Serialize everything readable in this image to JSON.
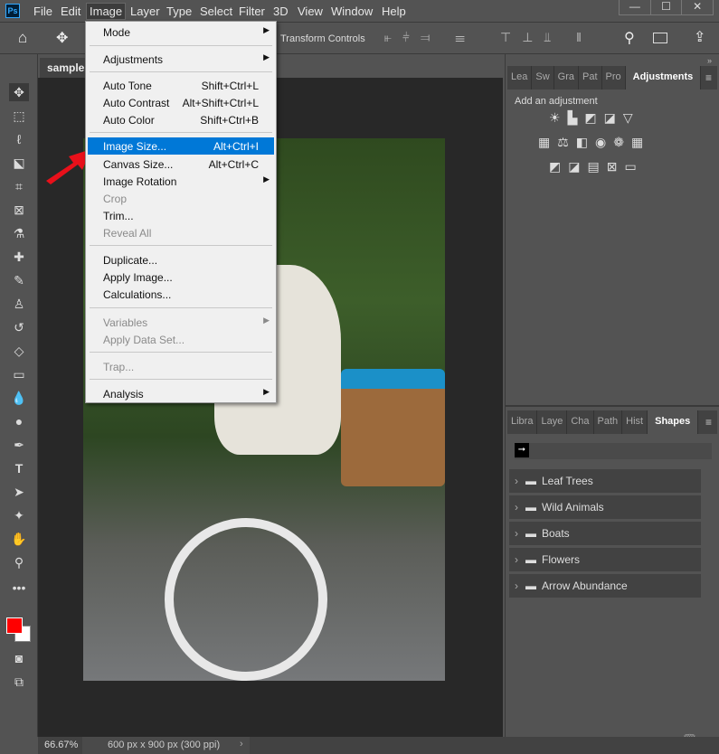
{
  "app": {
    "logo": "Ps"
  },
  "menubar": [
    "File",
    "Edit",
    "Image",
    "Layer",
    "Type",
    "Select",
    "Filter",
    "3D",
    "View",
    "Window",
    "Help"
  ],
  "window_controls": {
    "minimize": "—",
    "maximize": "☐",
    "close": "✕"
  },
  "options_bar": {
    "transform_label": "Transform Controls"
  },
  "document": {
    "tab": "sample.",
    "zoom": "66.67%",
    "info": "600 px x 900 px (300 ppi)"
  },
  "image_menu": {
    "mode": "Mode",
    "adjustments": "Adjustments",
    "auto_tone": {
      "label": "Auto Tone",
      "shortcut": "Shift+Ctrl+L"
    },
    "auto_contrast": {
      "label": "Auto Contrast",
      "shortcut": "Alt+Shift+Ctrl+L"
    },
    "auto_color": {
      "label": "Auto Color",
      "shortcut": "Shift+Ctrl+B"
    },
    "image_size": {
      "label": "Image Size...",
      "shortcut": "Alt+Ctrl+I"
    },
    "canvas_size": {
      "label": "Canvas Size...",
      "shortcut": "Alt+Ctrl+C"
    },
    "image_rotation": "Image Rotation",
    "crop": "Crop",
    "trim": "Trim...",
    "reveal_all": "Reveal All",
    "duplicate": "Duplicate...",
    "apply_image": "Apply Image...",
    "calculations": "Calculations...",
    "variables": "Variables",
    "apply_data_set": "Apply Data Set...",
    "trap": "Trap...",
    "analysis": "Analysis"
  },
  "adjustments_panel": {
    "tabs": [
      "Lea",
      "Sw",
      "Gra",
      "Pat",
      "Pro",
      "Adjustments"
    ],
    "title": "Add an adjustment"
  },
  "shapes_panel": {
    "tabs": [
      "Libra",
      "Laye",
      "Cha",
      "Path",
      "Hist",
      "Shapes"
    ],
    "items": [
      "Leaf Trees",
      "Wild Animals",
      "Boats",
      "Flowers",
      "Arrow Abundance"
    ]
  },
  "colors": {
    "foreground": "#ff0000",
    "background": "#ffffff",
    "highlight": "#0078d7",
    "arrow": "#e8101a"
  }
}
